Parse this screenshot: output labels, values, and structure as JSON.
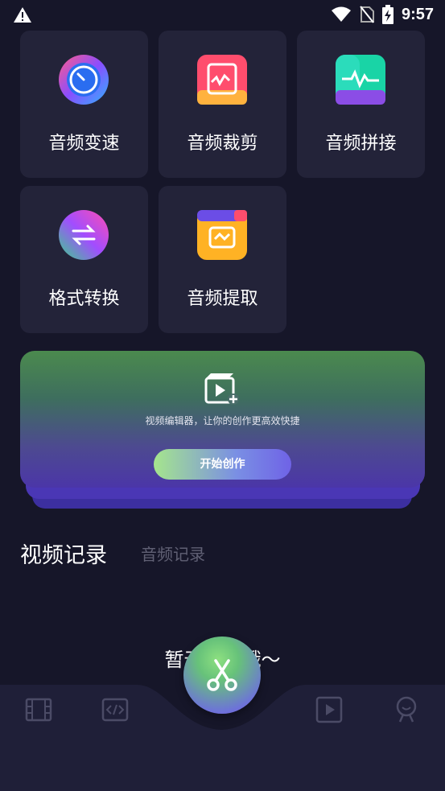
{
  "status_bar": {
    "time": "9:57"
  },
  "tools": [
    {
      "label": "音频变速",
      "icon": "speed-dial-icon"
    },
    {
      "label": "音频裁剪",
      "icon": "crop-icon"
    },
    {
      "label": "音频拼接",
      "icon": "waveform-join-icon"
    },
    {
      "label": "格式转换",
      "icon": "convert-icon"
    },
    {
      "label": "音频提取",
      "icon": "extract-icon"
    }
  ],
  "banner": {
    "subtitle": "视频编辑器，让你的创作更高效快捷",
    "button": "开始创作",
    "icon": "video-add-icon"
  },
  "tabs": {
    "video": "视频记录",
    "audio": "音频记录"
  },
  "empty_state": "暂无记录哦～",
  "bottom_nav": [
    "film-icon",
    "code-icon",
    "play-icon",
    "profile-icon"
  ],
  "fab": {
    "icon": "scissors-icon"
  }
}
